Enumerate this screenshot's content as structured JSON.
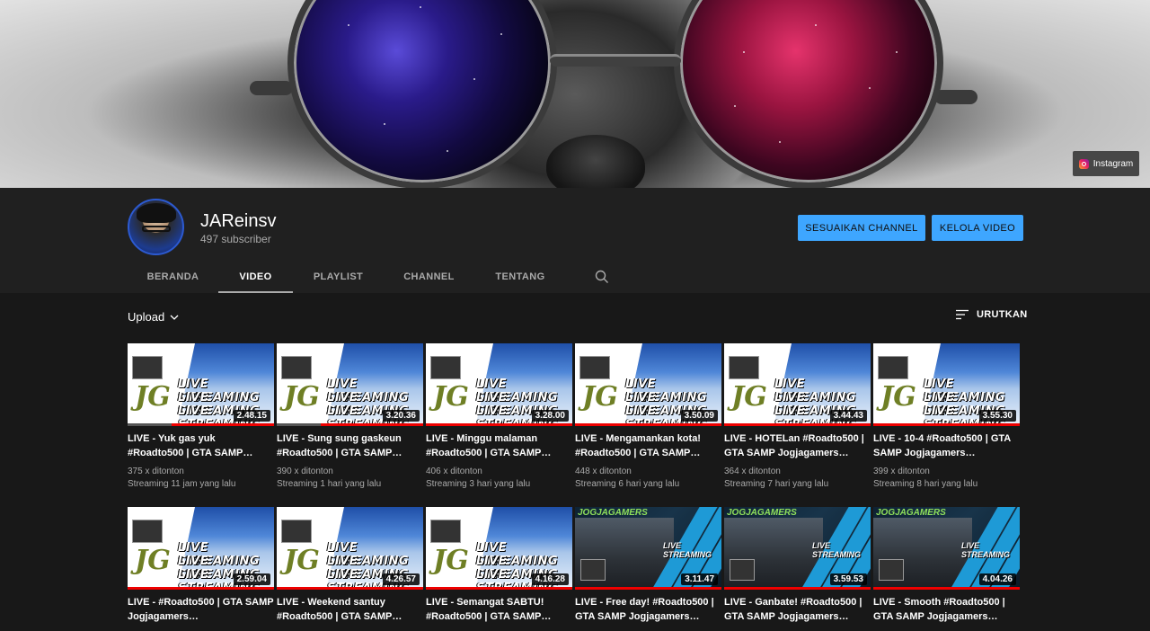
{
  "banner": {
    "link_label": "Instagram"
  },
  "channel": {
    "name": "JAReinsv",
    "subscribers": "497 subscriber"
  },
  "buttons": {
    "customize": "SESUAIKAN CHANNEL",
    "manage": "KELOLA VIDEO"
  },
  "tabs": [
    {
      "label": "BERANDA",
      "active": false
    },
    {
      "label": "VIDEO",
      "active": true
    },
    {
      "label": "PLAYLIST",
      "active": false
    },
    {
      "label": "CHANNEL",
      "active": false
    },
    {
      "label": "TENTANG",
      "active": false
    }
  ],
  "toolbar": {
    "filter_label": "Upload",
    "sort_label": "URUTKAN"
  },
  "thumb_text": {
    "brand": "JG",
    "live": "LIVE STREAMING",
    "live_short": "LIVE STREAMING",
    "brand2": "JOGJAGAMERS"
  },
  "videos": [
    {
      "title": "LIVE - Yuk gas yuk #Roadto500 | GTA SAMP…",
      "views": "375 x ditonton",
      "age": "Streaming 11 jam yang lalu",
      "duration": "2.48.15",
      "style": "v1",
      "watched": 0.3
    },
    {
      "title": "LIVE - Sung sung gaskeun #Roadto500 | GTA SAMP…",
      "views": "390 x ditonton",
      "age": "Streaming 1 hari yang lalu",
      "duration": "3.20.36",
      "style": "v1",
      "watched": 0.3
    },
    {
      "title": "LIVE - Minggu malaman #Roadto500 | GTA SAMP…",
      "views": "406 x ditonton",
      "age": "Streaming 3 hari yang lalu",
      "duration": "3.28.00",
      "style": "v1",
      "watched": 0
    },
    {
      "title": "LIVE - Mengamankan kota! #Roadto500 | GTA SAMP…",
      "views": "448 x ditonton",
      "age": "Streaming 6 hari yang lalu",
      "duration": "3.50.09",
      "style": "v1",
      "watched": 0
    },
    {
      "title": "LIVE - HOTELan #Roadto500 | GTA SAMP Jogjagamers…",
      "views": "364 x ditonton",
      "age": "Streaming 7 hari yang lalu",
      "duration": "3.44.43",
      "style": "v1",
      "watched": 0
    },
    {
      "title": "LIVE - 10-4 #Roadto500 | GTA SAMP Jogjagamers…",
      "views": "399 x ditonton",
      "age": "Streaming 8 hari yang lalu",
      "duration": "3.55.30",
      "style": "v1",
      "watched": 0
    },
    {
      "title": "LIVE - #Roadto500 | GTA SAMP Jogjagamers…",
      "views": "",
      "age": "",
      "duration": "2.59.04",
      "style": "v1",
      "watched": 0
    },
    {
      "title": "LIVE - Weekend santuy #Roadto500 | GTA SAMP…",
      "views": "",
      "age": "",
      "duration": "4.26.57",
      "style": "v1",
      "watched": 0
    },
    {
      "title": "LIVE - Semangat SABTU! #Roadto500 | GTA SAMP…",
      "views": "",
      "age": "",
      "duration": "4.16.28",
      "style": "v1",
      "watched": 0
    },
    {
      "title": "LIVE - Free day! #Roadto500 | GTA SAMP Jogjagamers…",
      "views": "",
      "age": "",
      "duration": "3.11.47",
      "style": "v2",
      "watched": 0
    },
    {
      "title": "LIVE - Ganbate! #Roadto500 | GTA SAMP Jogjagamers…",
      "views": "",
      "age": "",
      "duration": "3.59.53",
      "style": "v2",
      "watched": 0
    },
    {
      "title": "LIVE - Smooth #Roadto500 | GTA SAMP Jogjagamers…",
      "views": "",
      "age": "",
      "duration": "4.04.26",
      "style": "v2",
      "watched": 0
    }
  ],
  "colors": {
    "accent": "#3ea6ff",
    "background": "#181818",
    "header": "#202020",
    "live_bar": "#e00000"
  }
}
